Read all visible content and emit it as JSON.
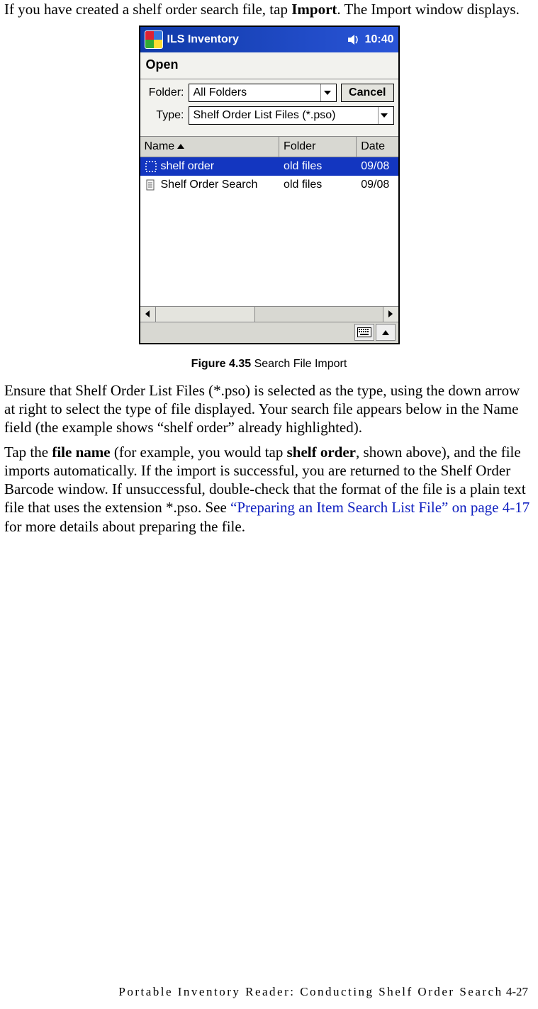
{
  "intro": {
    "pre": "If you have created a shelf order search file, tap ",
    "bold": "Import",
    "post": ". The Import window displays."
  },
  "device": {
    "titlebar": {
      "title": "ILS Inventory",
      "time": "10:40"
    },
    "open_label": "Open",
    "form": {
      "folder_label": "Folder:",
      "folder_value": "All Folders",
      "cancel": "Cancel",
      "type_label": "Type:",
      "type_value": "Shelf Order List Files (*.pso)"
    },
    "columns": {
      "name": "Name",
      "folder": "Folder",
      "date": "Date"
    },
    "rows": [
      {
        "name": "shelf order",
        "folder": "old files",
        "date": "09/08",
        "selected": true
      },
      {
        "name": "Shelf Order Search",
        "folder": "old files",
        "date": "09/08",
        "selected": false
      }
    ]
  },
  "caption": {
    "label": "Figure 4.35",
    "text": " Search File Import"
  },
  "para2": "Ensure that Shelf Order List Files (*.pso) is selected as the type, using the down arrow at right to select the type of file displayed. Your search file appears below in the Name field (the example shows “shelf order” already highlighted).",
  "para3": {
    "t1": "Tap the ",
    "b1": "file name",
    "t2": " (for example, you would tap ",
    "b2": "shelf order",
    "t3": ", shown above), and the file imports automatically. If the import is successful, you are returned to the Shelf Order Barcode window. If unsuccessful, double-check that the format of the file is a plain text file that uses the extension *.pso. See ",
    "link": "“Preparing an Item Search List File” on page 4-17",
    "t4": " for more details about preparing the file."
  },
  "footer": {
    "title": "Portable Inventory Reader: Conducting Shelf Order Search",
    "page": "4-27"
  }
}
